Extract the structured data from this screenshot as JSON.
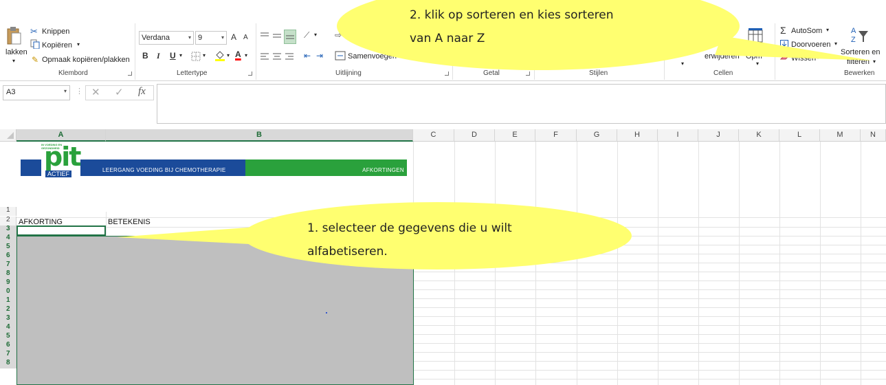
{
  "ribbon": {
    "clipboard": {
      "paste_label": "lakken",
      "cut_label": "Knippen",
      "copy_label": "Kopiëren",
      "format_painter_label": "Opmaak kopiëren/plakken",
      "group_label": "Klembord"
    },
    "font": {
      "font_name": "Verdana",
      "font_size": "9",
      "bold": "B",
      "italic": "I",
      "underline": "U",
      "grow": "A",
      "shrink": "A",
      "color_a": "A",
      "group_label": "Lettertype"
    },
    "alignment": {
      "merge_label": "Samenvoegen",
      "group_label": "Uitlijning"
    },
    "number": {
      "group_label": "Getal"
    },
    "styles": {
      "group_label": "Stijlen"
    },
    "cells": {
      "delete_label": "erwijderen",
      "format_label": "Opm",
      "group_label": "Cellen"
    },
    "editing": {
      "autosum_label": "AutoSom",
      "fill_label": "Doorvoeren",
      "clear_label": "Wissen",
      "sort_label_1": "Sorteren en",
      "sort_label_2": "filteren",
      "group_label": "Bewerken"
    }
  },
  "formula_bar": {
    "name_box": "A3",
    "fx": "fx",
    "cancel": "✕",
    "enter": "✓",
    "formula": ""
  },
  "grid": {
    "columns": [
      "A",
      "B",
      "C",
      "D",
      "E",
      "F",
      "G",
      "H",
      "I",
      "J",
      "K",
      "L",
      "M",
      "N"
    ],
    "rows": [
      "1",
      "2",
      "3",
      "4",
      "5",
      "6",
      "7",
      "8",
      "9",
      "0",
      "1",
      "2",
      "3",
      "4",
      "5",
      "6",
      "7",
      "8"
    ],
    "cells": {
      "A2": "AFKORTING",
      "B2": "BETEKENIS"
    },
    "banner": {
      "logo_top": "IN VOEDING EN GEZONDHEID",
      "logo_main": "pit",
      "logo_sub": "ACTIEF",
      "title": "LEERGANG VOEDING BIJ CHEMOTHERAPIE",
      "right": "AFKORTINGEN"
    }
  },
  "callouts": {
    "step1_line1": "1. selecteer de gegevens die u wilt",
    "step1_line2": "alfabetiseren.",
    "step2_line1": "2. klik op sorteren en kies sorteren",
    "step2_line2": "van A naar Z"
  },
  "colors": {
    "excel_green": "#217346",
    "callout_yellow": "#ffff70",
    "banner_blue": "#1b4b9a",
    "banner_green": "#2aa13c",
    "selection_gray": "#bfbfbf"
  }
}
